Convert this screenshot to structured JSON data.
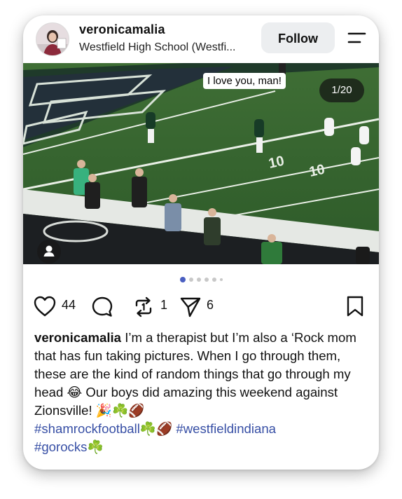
{
  "post": {
    "username": "veronicamalia",
    "location": "Westfield High School (Westfi...",
    "follow_label": "Follow",
    "media": {
      "overlay_text": "I love you, man!",
      "counter": "1/20",
      "dots_total": 6,
      "dots_active_index": 0
    },
    "actions": {
      "likes": "44",
      "reposts": "1",
      "shares": "6"
    },
    "caption": {
      "username": "veronicamalia",
      "text": "I’m a therapist but I’m also a ‘Rock mom that has fun taking pictures. When I go through them, these are the kind of random things that go through my head 😂 Our boys did amazing this weekend against Zionsville! 🎉☘️🏈",
      "hashtag_1": "#shamrockfootball☘️🏈",
      "hashtag_2": "#westfieldindiana",
      "hashtag_3": "#gorocks☘️"
    },
    "colors": {
      "accent_blue": "#374fa5",
      "dot_active": "#4a5fc1",
      "dot_inactive": "#c8c8c8"
    }
  }
}
